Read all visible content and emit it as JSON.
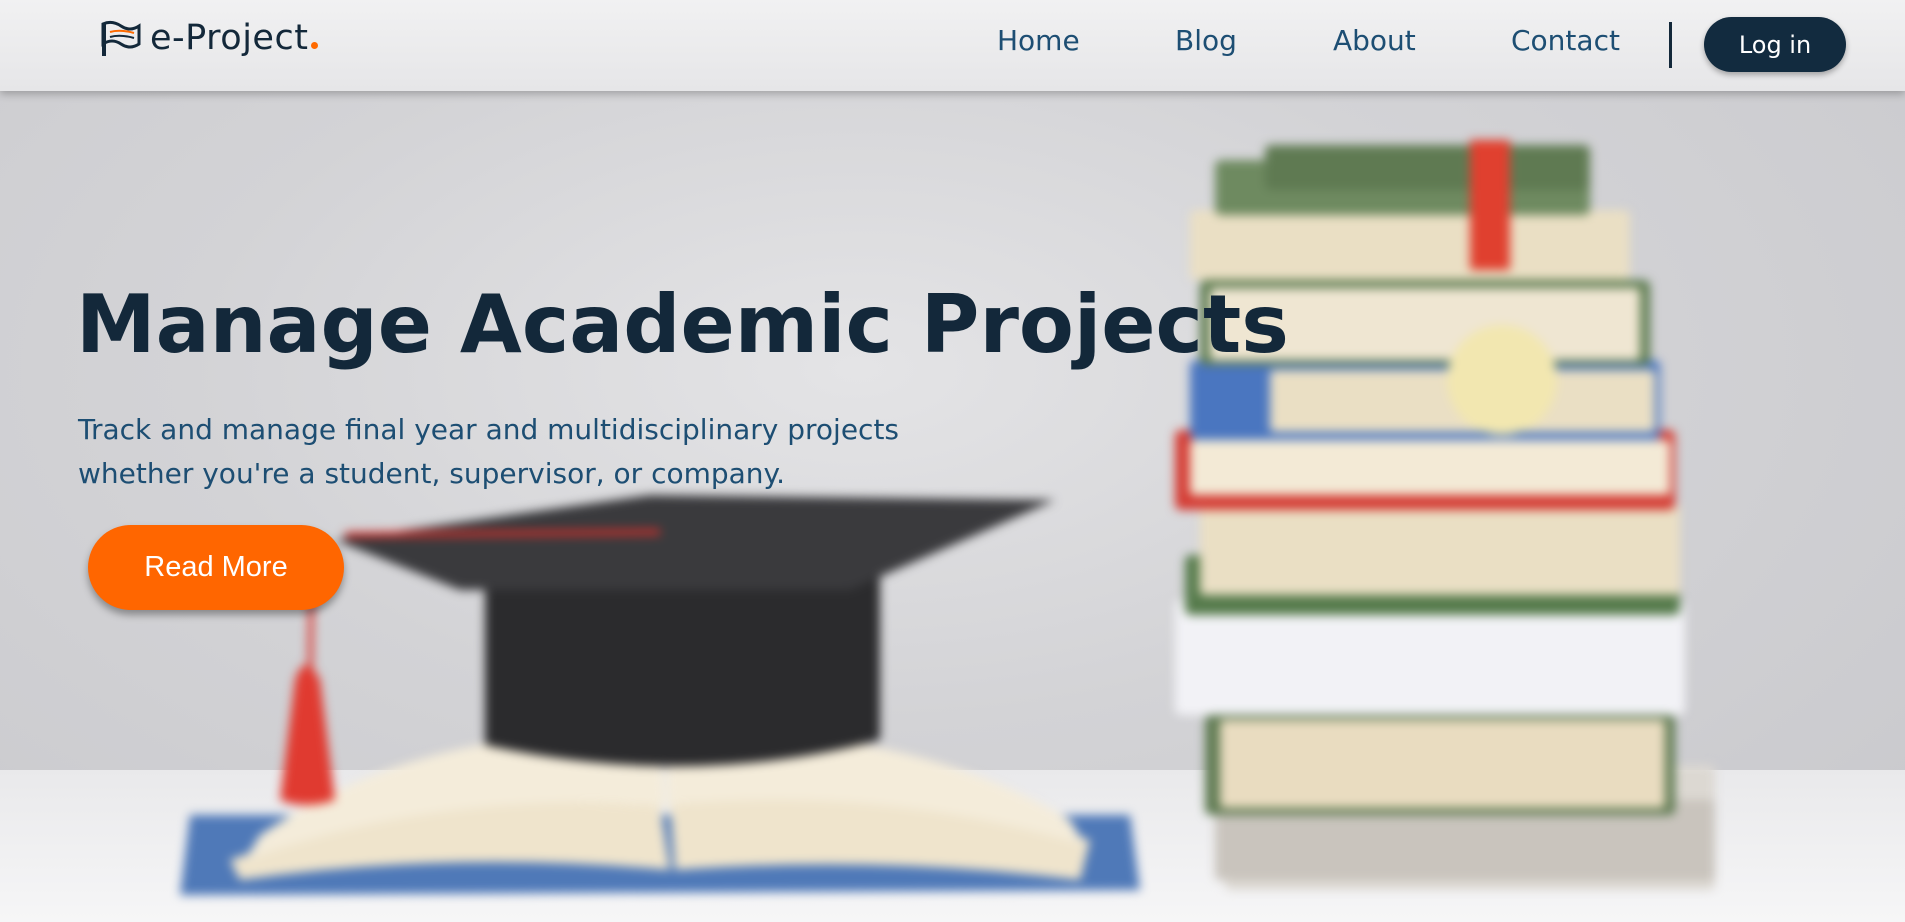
{
  "brand": {
    "name": "e-Project",
    "accent": "#ff6600",
    "dark": "#13283a",
    "link_color": "#1d4e73"
  },
  "nav": {
    "items": [
      {
        "label": "Home"
      },
      {
        "label": "Blog"
      },
      {
        "label": "About"
      },
      {
        "label": "Contact"
      }
    ],
    "login_label": "Log in"
  },
  "hero": {
    "title": "Manage Academic Projects",
    "subtitle_line1": "Track and manage final year and multidisciplinary projects",
    "subtitle_line2": "whether you're a student, supervisor, or company.",
    "cta_label": "Read More",
    "image_icon": "graduation-cap-and-books-image"
  }
}
